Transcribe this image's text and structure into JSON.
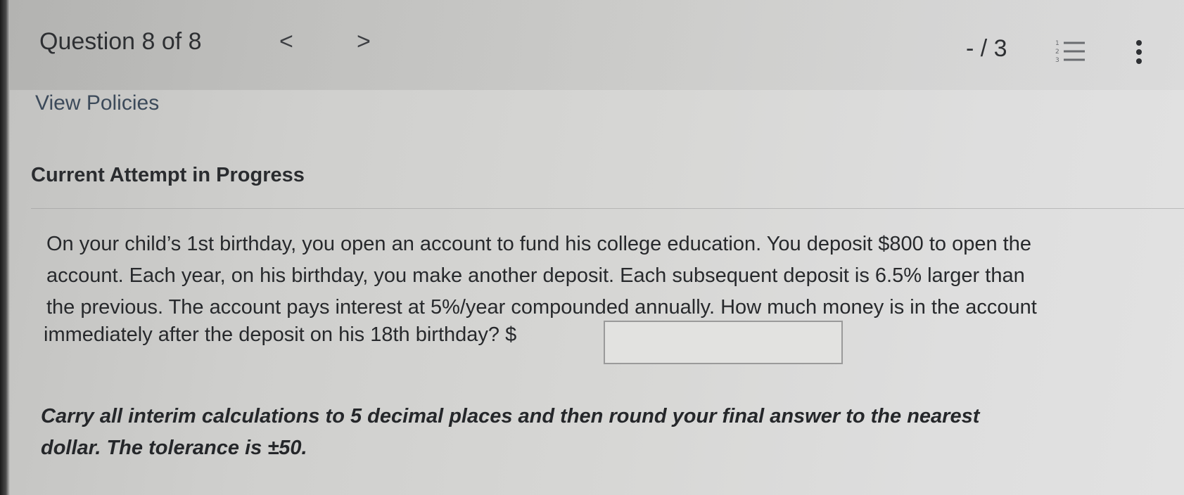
{
  "header": {
    "question_counter": "Question 8 of 8",
    "prev_arrow": "<",
    "next_arrow": ">",
    "score": "- / 3",
    "list_icon": "numbered-list-icon",
    "menu_icon": "kebab-menu-icon"
  },
  "links": {
    "view_policies": "View Policies"
  },
  "section": {
    "title": "Current Attempt in Progress"
  },
  "question": {
    "lines": [
      "On your child’s 1st birthday, you open an account to fund his college education. You deposit $800 to open the",
      "account. Each year, on his birthday, you make another deposit. Each subsequent deposit is 6.5% larger than",
      "the previous. The account pays interest at 5%/year compounded annually. How much money is in the account"
    ],
    "last_line": "immediately after the deposit on his 18th birthday? $",
    "answer_value": ""
  },
  "instructions": {
    "line1": "Carry all interim calculations to 5 decimal places and then round your final answer to the nearest",
    "line2": "dollar. The tolerance is ±50."
  }
}
